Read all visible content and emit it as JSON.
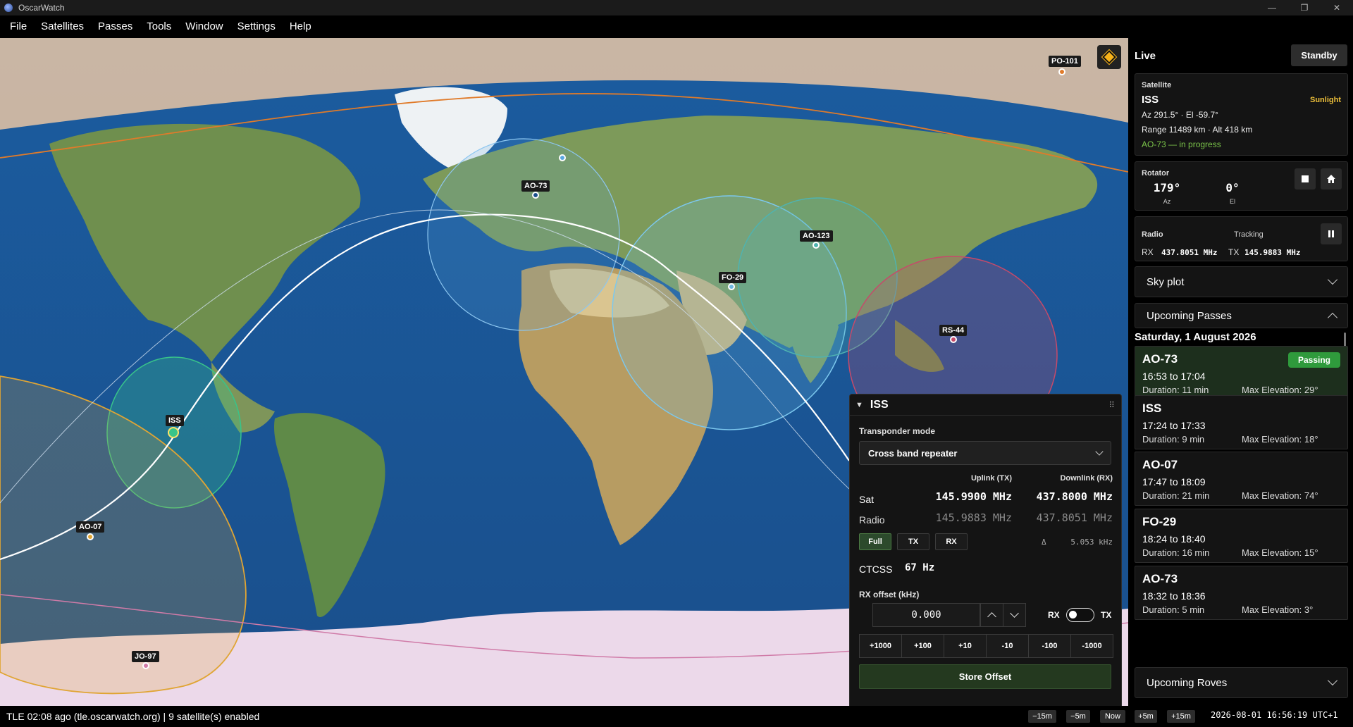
{
  "window": {
    "title": "OscarWatch",
    "minimize": "—",
    "maximize": "❐",
    "close": "✕"
  },
  "menu": [
    "File",
    "Satellites",
    "Passes",
    "Tools",
    "Window",
    "Settings",
    "Help"
  ],
  "map": {
    "satellites": [
      {
        "name": "PO-101",
        "color": "#e07b2a"
      },
      {
        "name": "AO-73",
        "color": "#9ec9f0"
      },
      {
        "name": "AO-123",
        "color": "#4fb3b0"
      },
      {
        "name": "FO-29",
        "color": "#6fb7e0"
      },
      {
        "name": "RS-44",
        "color": "#c64a6a"
      },
      {
        "name": "ISS",
        "color": "#38c48a"
      },
      {
        "name": "AO-07",
        "color": "#e0a534"
      },
      {
        "name": "JO-97",
        "color": "#d07ba8"
      }
    ]
  },
  "iss_panel": {
    "title": "ISS",
    "transponder_label": "Transponder mode",
    "transponder_value": "Cross band repeater",
    "uplink_header": "Uplink (TX)",
    "downlink_header": "Downlink (RX)",
    "sat_label": "Sat",
    "sat_uplink": "145.9900 MHz",
    "sat_downlink": "437.8000 MHz",
    "radio_label": "Radio",
    "radio_uplink": "145.9883 MHz",
    "radio_downlink": "437.8051 MHz",
    "mode_buttons": [
      "Full",
      "TX",
      "RX"
    ],
    "delta_symbol": "Δ",
    "delta_value": "5.053 kHz",
    "ctcss_label": "CTCSS",
    "ctcss_value": "67 Hz",
    "offset_label": "RX offset (kHz)",
    "offset_value": "0.000",
    "toggle_left": "RX",
    "toggle_right": "TX",
    "steps": [
      "+1000",
      "+100",
      "+10",
      "-10",
      "-100",
      "-1000"
    ],
    "store_label": "Store Offset"
  },
  "sidebar": {
    "live_label": "Live",
    "standby_label": "Standby",
    "satellite": {
      "caption": "Satellite",
      "name": "ISS",
      "sunlight": "Sunlight",
      "az_el": "Az 291.5°  ·  El -59.7°",
      "range_alt": "Range 11489 km  ·  Alt 418 km",
      "pass_status": "AO-73 — in progress"
    },
    "rotator": {
      "caption": "Rotator",
      "az": "179°",
      "az_label": "Az",
      "el": "0°",
      "el_label": "El"
    },
    "radio": {
      "caption": "Radio",
      "tracking": "Tracking",
      "rx_label": "RX",
      "rx_value": "437.8051 MHz",
      "tx_label": "TX",
      "tx_value": "145.9883 MHz"
    },
    "sky_plot": "Sky plot",
    "upcoming_passes": "Upcoming Passes",
    "date_header": "Saturday, 1 August 2026",
    "passes": [
      {
        "name": "AO-73",
        "time": "16:53 to 17:04",
        "duration": "Duration: 11 min",
        "max_el": "Max Elevation: 29°",
        "badge": "Passing"
      },
      {
        "name": "ISS",
        "time": "17:24 to 17:33",
        "duration": "Duration: 9 min",
        "max_el": "Max Elevation: 18°"
      },
      {
        "name": "AO-07",
        "time": "17:47 to 18:09",
        "duration": "Duration: 21 min",
        "max_el": "Max Elevation: 74°"
      },
      {
        "name": "FO-29",
        "time": "18:24 to 18:40",
        "duration": "Duration: 16 min",
        "max_el": "Max Elevation: 15°"
      },
      {
        "name": "AO-73",
        "time": "18:32 to 18:36",
        "duration": "Duration: 5 min",
        "max_el": "Max Elevation: 3°"
      }
    ],
    "upcoming_roves": "Upcoming Roves"
  },
  "status": {
    "text": "TLE 02:08 ago (tle.oscarwatch.org) | 9 satellite(s) enabled",
    "time_buttons": [
      "−15m",
      "−5m",
      "Now",
      "+5m",
      "+15m"
    ],
    "clock": "2026-08-01 16:56:19 UTC+1"
  }
}
